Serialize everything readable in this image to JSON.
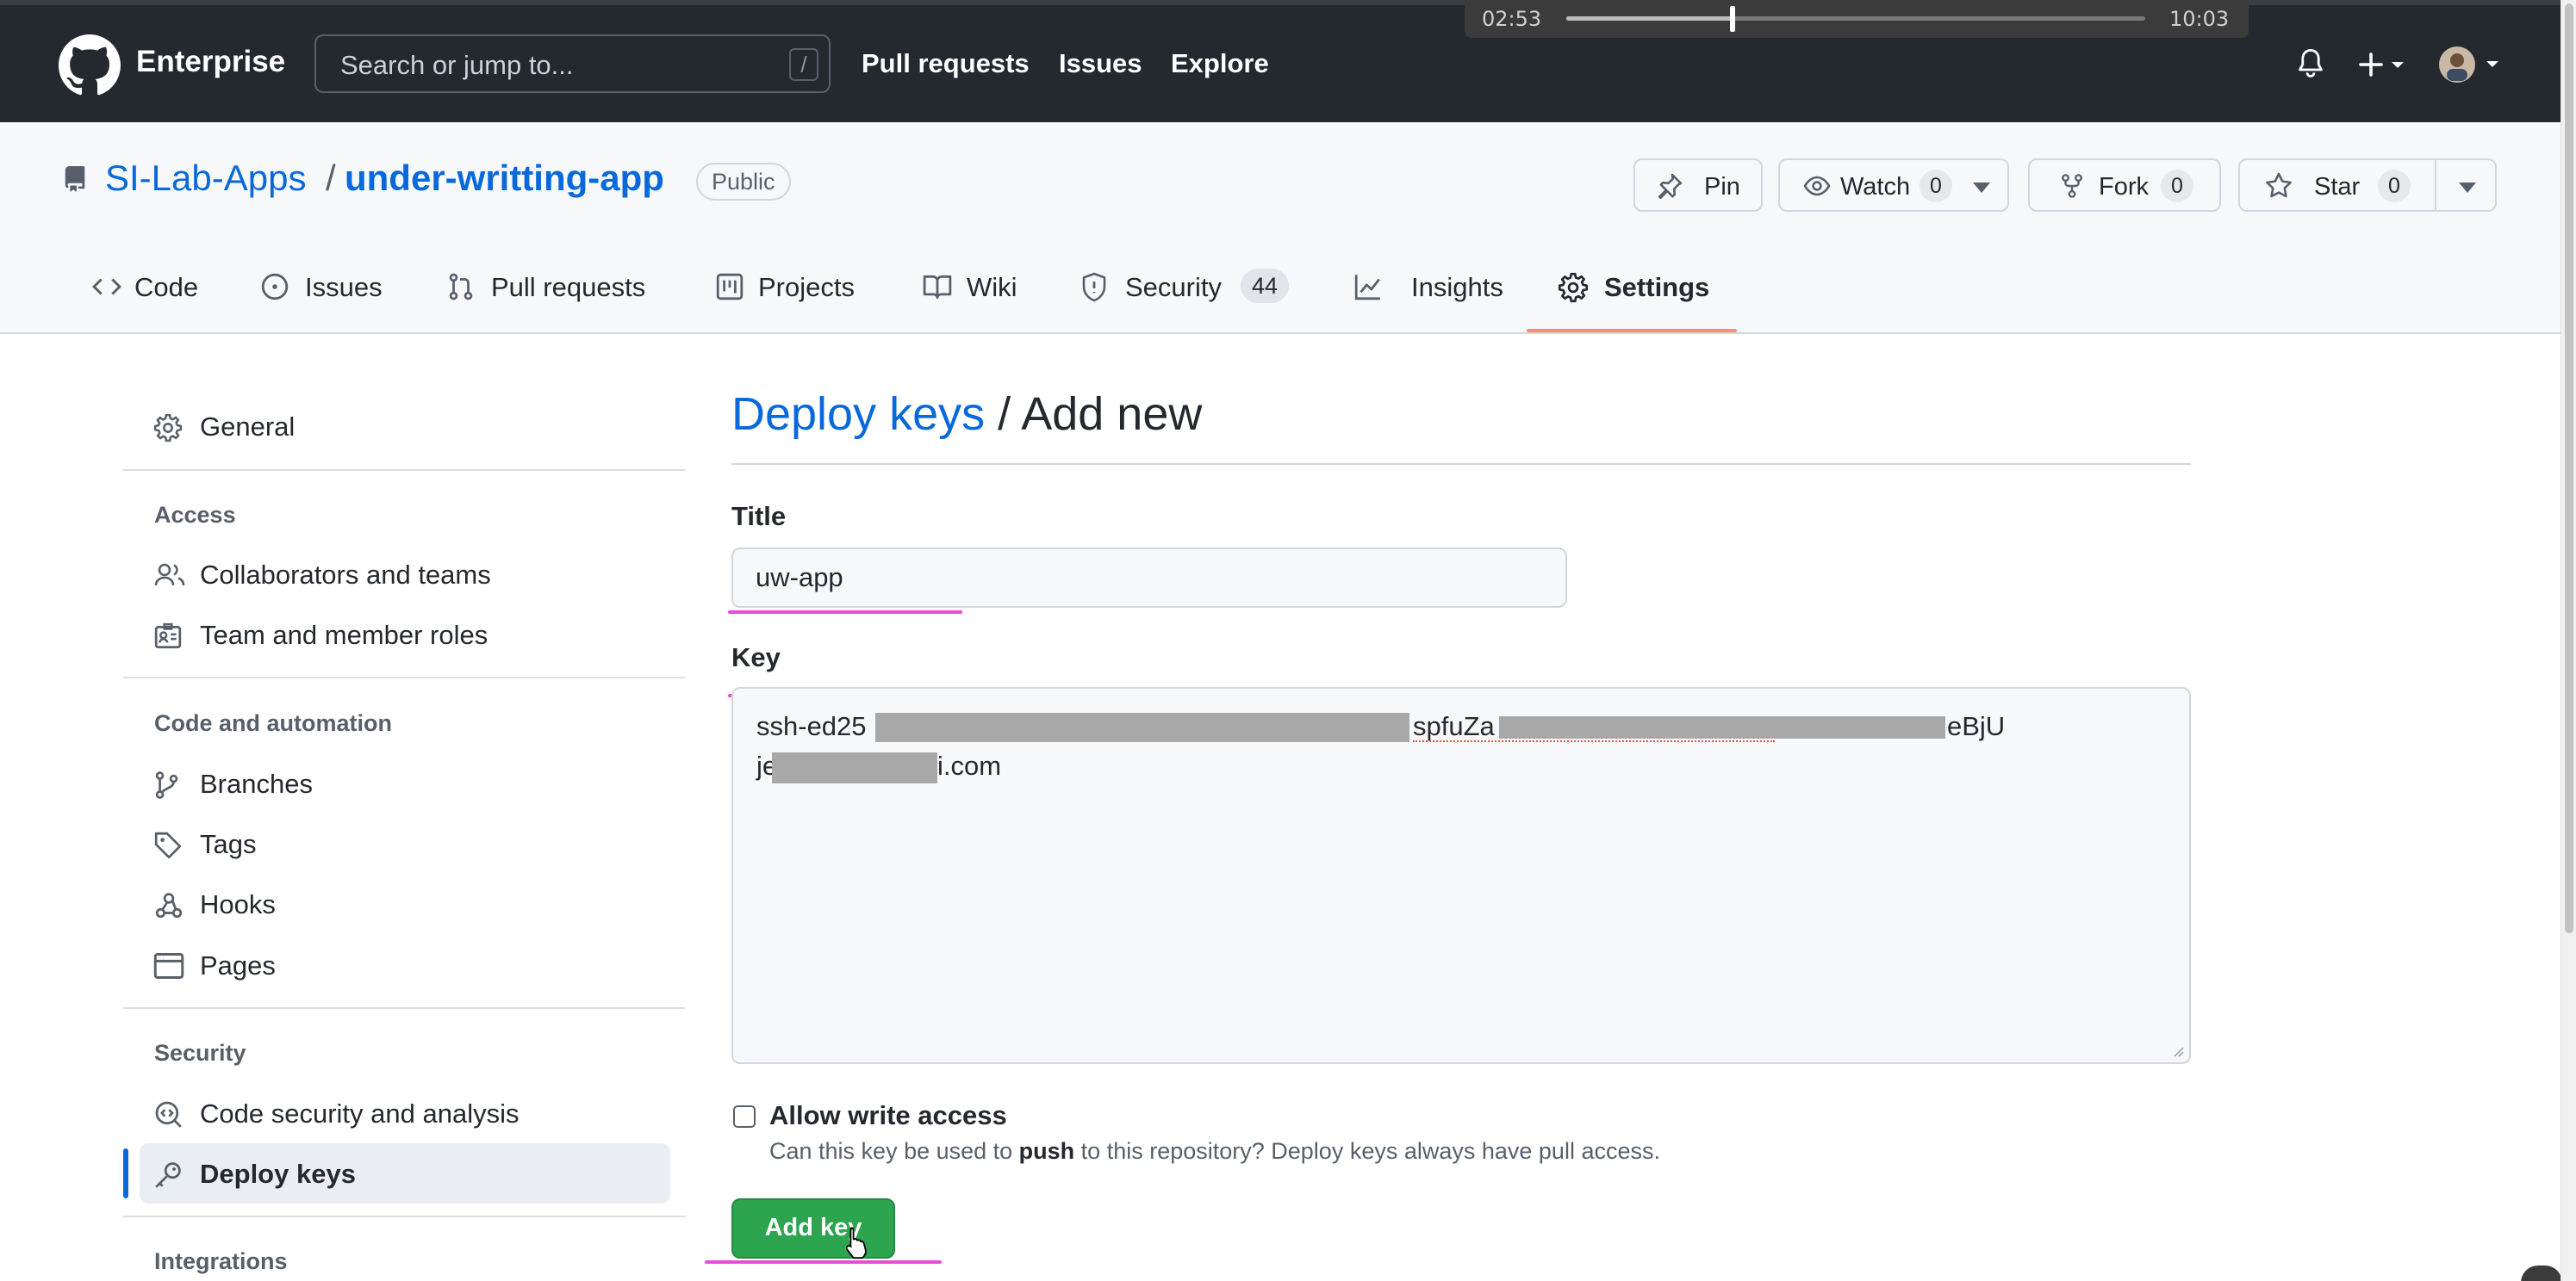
{
  "header": {
    "brand": "Enterprise",
    "search_placeholder": "Search or jump to...",
    "search_shortcut": "/",
    "nav": [
      "Pull requests",
      "Issues",
      "Explore"
    ],
    "icons": [
      "bell-icon",
      "plus-icon",
      "avatar"
    ]
  },
  "video": {
    "elapsed": "02:53",
    "total": "10:03",
    "progress": 0.287
  },
  "repo": {
    "owner": "SI-Lab-Apps",
    "separator": "/",
    "name": "under-writting-app",
    "visibility": "Public",
    "actions": {
      "pin": "Pin",
      "watch": "Watch",
      "watch_count": "0",
      "fork": "Fork",
      "fork_count": "0",
      "star": "Star",
      "star_count": "0"
    }
  },
  "tabs": [
    {
      "label": "Code",
      "icon": "code-icon"
    },
    {
      "label": "Issues",
      "icon": "issue-icon"
    },
    {
      "label": "Pull requests",
      "icon": "pull-request-icon"
    },
    {
      "label": "Projects",
      "icon": "project-icon"
    },
    {
      "label": "Wiki",
      "icon": "book-icon"
    },
    {
      "label": "Security",
      "icon": "shield-icon",
      "count": "44"
    },
    {
      "label": "Insights",
      "icon": "graph-icon"
    },
    {
      "label": "Settings",
      "icon": "gear-icon",
      "selected": true
    }
  ],
  "sidebar": {
    "general": "General",
    "access_heading": "Access",
    "access": [
      "Collaborators and teams",
      "Team and member roles"
    ],
    "code_heading": "Code and automation",
    "code": [
      "Branches",
      "Tags",
      "Hooks",
      "Pages"
    ],
    "security_heading": "Security",
    "security": [
      "Code security and analysis",
      "Deploy keys"
    ],
    "integrations_heading": "Integrations"
  },
  "form": {
    "crumb_link": "Deploy keys",
    "crumb_sep": "/",
    "crumb_current": "Add new",
    "title_label": "Title",
    "title_value": "uw-app",
    "key_label": "Key",
    "key_line1_a": "ssh-ed25",
    "key_line1_b": "spfuZa",
    "key_line1_c": "eBjU",
    "key_line2_a": "je",
    "key_line2_b": "i.com",
    "write_access_label": "Allow write access",
    "write_access_note_pre": "Can this key be used to ",
    "write_access_note_bold": "push",
    "write_access_note_post": " to this repository? Deploy keys always have pull access.",
    "write_access_checked": false,
    "submit": "Add key"
  },
  "colors": {
    "header_bg": "#24292f",
    "link": "#0969da",
    "primary_button": "#2da44e",
    "selected_tab_underline": "#fd8c73",
    "annotation_marker": "#e64ed8"
  }
}
